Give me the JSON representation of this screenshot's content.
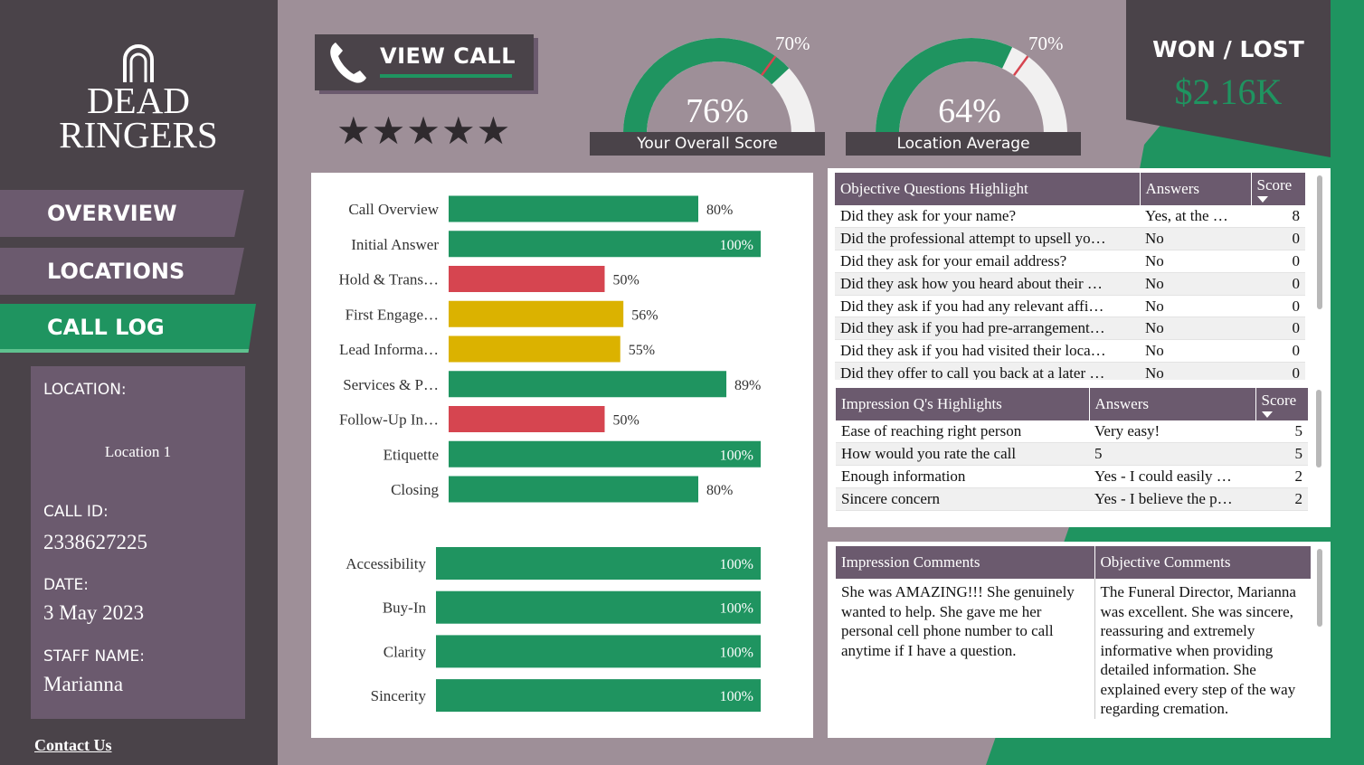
{
  "brand": {
    "line1": "DEAD",
    "line2": "RINGERS",
    "icon": "headstone-icon"
  },
  "nav": {
    "overview": "OVERVIEW",
    "locations": "LOCATIONS",
    "call_log": "CALL LOG"
  },
  "info": {
    "location_label": "LOCATION:",
    "location_value": "Location 1",
    "call_id_label": "CALL ID:",
    "call_id_value": "2338627225",
    "date_label": "DATE:",
    "date_value": "3 May 2023",
    "staff_label": "STAFF NAME:",
    "staff_value": "Marianna"
  },
  "contact": "Contact Us",
  "view_call": {
    "label": "VIEW CALL",
    "icon": "phone-icon"
  },
  "rating": {
    "stars": "★★★★★",
    "value": 5,
    "max": 5
  },
  "gauges": [
    {
      "label": "Your Overall Score",
      "value_text": "76%",
      "value": 76,
      "target_text": "70%",
      "target": 70
    },
    {
      "label": "Location Average",
      "value_text": "64%",
      "value": 64,
      "target_text": "70%",
      "target": 70
    }
  ],
  "won_lost": {
    "title": "WON / LOST",
    "value": "$2.16K"
  },
  "colors": {
    "green": "#1f9460",
    "red": "#d64550",
    "yellow": "#dbb200",
    "purple": "#6b5a6e",
    "dark": "#4a4349"
  },
  "chart_data": [
    {
      "type": "bar",
      "orientation": "horizontal",
      "categories": [
        "Call Overview",
        "Initial Answer",
        "Hold & Trans…",
        "First Engage…",
        "Lead Informa…",
        "Services & P…",
        "Follow-Up In…",
        "Etiquette",
        "Closing"
      ],
      "values": [
        80,
        100,
        50,
        56,
        55,
        89,
        50,
        100,
        80
      ],
      "labels": [
        "80%",
        "100%",
        "50%",
        "56%",
        "55%",
        "89%",
        "50%",
        "100%",
        "80%"
      ],
      "colors": [
        "#1f9460",
        "#1f9460",
        "#d64550",
        "#dbb200",
        "#dbb200",
        "#1f9460",
        "#d64550",
        "#1f9460",
        "#1f9460"
      ],
      "xlim": [
        0,
        100
      ]
    },
    {
      "type": "bar",
      "orientation": "horizontal",
      "categories": [
        "Accessibility",
        "Buy-In",
        "Clarity",
        "Sincerity"
      ],
      "values": [
        100,
        100,
        100,
        100
      ],
      "labels": [
        "100%",
        "100%",
        "100%",
        "100%"
      ],
      "colors": [
        "#1f9460",
        "#1f9460",
        "#1f9460",
        "#1f9460"
      ],
      "xlim": [
        0,
        100
      ]
    }
  ],
  "objective_table": {
    "headers": [
      "Objective Questions Highlight",
      "Answers",
      "Score"
    ],
    "rows": [
      [
        "Did they ask for your name?",
        "Yes, at the …",
        "8"
      ],
      [
        "Did the professional attempt to upsell yo…",
        "No",
        "0"
      ],
      [
        "Did they ask for your email address?",
        "No",
        "0"
      ],
      [
        "Did they ask how you heard about their …",
        "No",
        "0"
      ],
      [
        "Did they ask if you had any relevant affi…",
        "No",
        "0"
      ],
      [
        "Did they ask if you had pre-arrangement…",
        "No",
        "0"
      ],
      [
        "Did they ask if you had visited their loca…",
        "No",
        "0"
      ],
      [
        "Did they offer to call you back at a later …",
        "No",
        "0"
      ]
    ]
  },
  "impression_table": {
    "headers": [
      "Impression Q's Highlights",
      "Answers",
      "Score"
    ],
    "rows": [
      [
        "Ease of reaching right person",
        "Very easy!",
        "5"
      ],
      [
        "How would you rate the call",
        "5",
        "5"
      ],
      [
        "Enough information",
        "Yes - I could easily …",
        "2"
      ],
      [
        "Sincere concern",
        "Yes - I believe the p…",
        "2"
      ]
    ]
  },
  "comments": {
    "headers": [
      "Impression Comments",
      "Objective Comments"
    ],
    "impression": "She was AMAZING!!! She genuinely wanted to help. She gave me her personal cell phone number to call anytime if I have a question.",
    "objective": "The Funeral Director, Marianna was excellent. She was sincere, reassuring and extremely informative when providing detailed information. She explained every step of the way regarding cremation."
  }
}
